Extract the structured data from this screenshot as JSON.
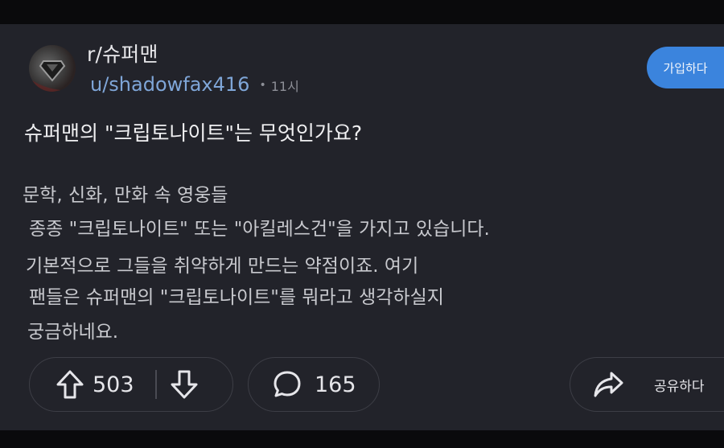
{
  "post": {
    "subreddit": "r/슈퍼맨",
    "username": "u/shadowfax416",
    "separator": "•",
    "time": "11시",
    "join_label": "가입하다",
    "title": "슈퍼맨의 \"크립토나이트\"는 무엇인가요?",
    "body_lines": [
      "문학, 신화, 만화 속 영웅들",
      "종종 \"크립토나이트\" 또는 \"아킬레스건\"을 가지고 있습니다.",
      "기본적으로 그들을 취약하게 만드는 약점이죠. 여기",
      "팬들은 슈퍼맨의 \"크립토나이트\"를 뭐라고 생각하실지",
      "궁금하네요."
    ]
  },
  "actions": {
    "upvote_icon": "arrow-up-icon",
    "vote_count": "503",
    "downvote_icon": "arrow-down-icon",
    "comment_icon": "speech-bubble-icon",
    "comment_count": "165",
    "share_icon": "share-arrow-icon",
    "share_label": "공유하다"
  },
  "colors": {
    "background": "#22232a",
    "join_button": "#3b84dd",
    "username": "#7fa6d8",
    "text": "#f0f0f2",
    "body_text": "#c8c9ce"
  }
}
